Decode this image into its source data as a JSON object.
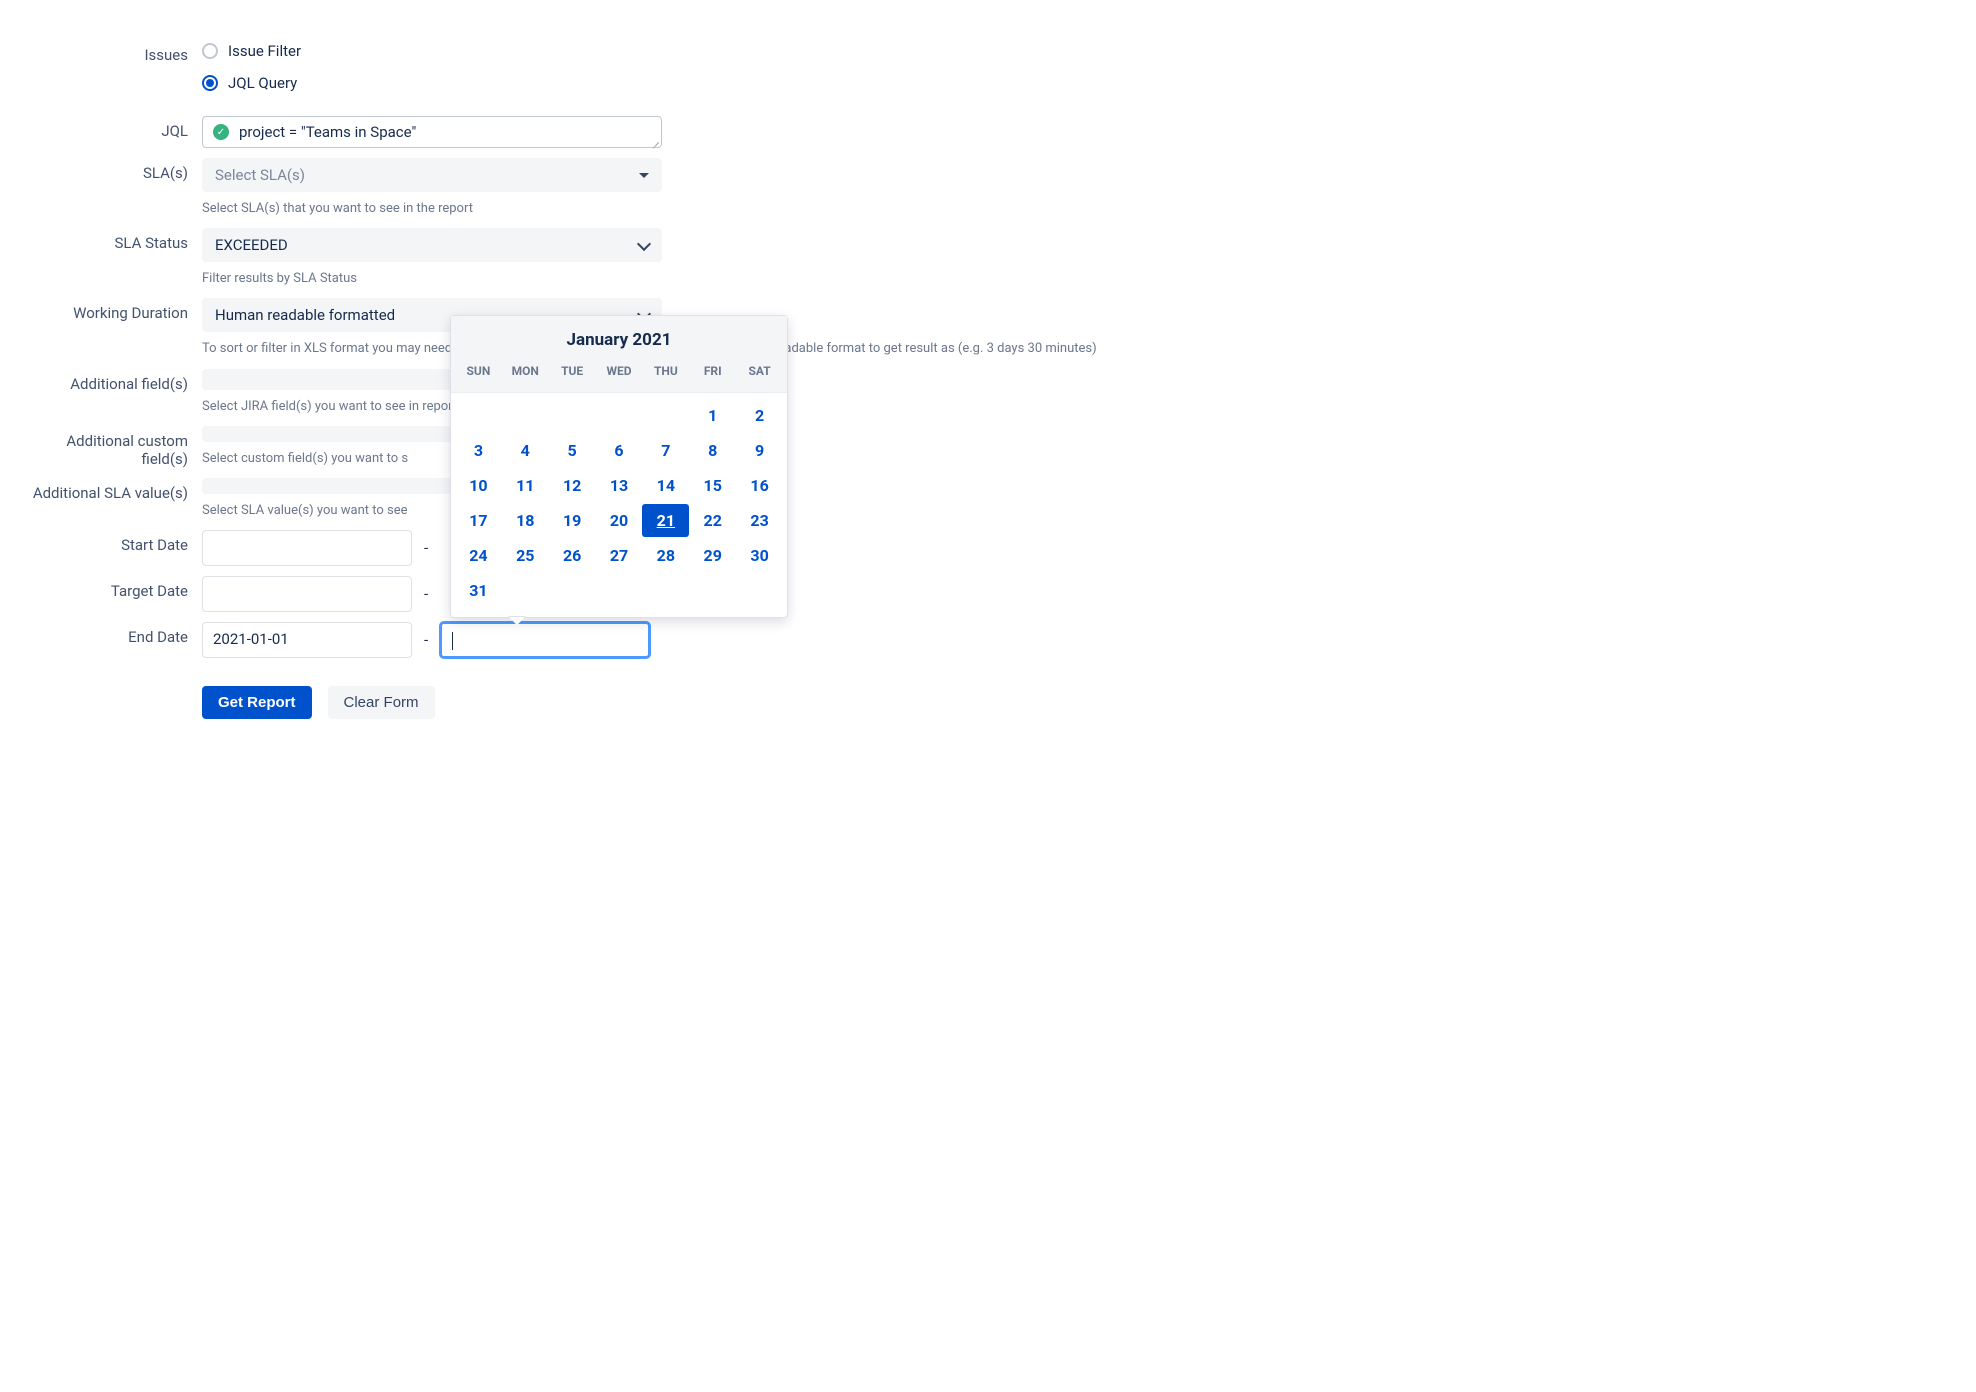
{
  "labels": {
    "issues": "Issues",
    "jql": "JQL",
    "slas": "SLA(s)",
    "sla_status": "SLA Status",
    "working_duration": "Working Duration",
    "additional_fields": "Additional field(s)",
    "additional_custom_fields": "Additional custom field(s)",
    "additional_sla_values": "Additional SLA value(s)",
    "start_date": "Start Date",
    "target_date": "Target Date",
    "end_date": "End Date"
  },
  "issues": {
    "option_filter": "Issue Filter",
    "option_jql": "JQL Query",
    "selected": "jql"
  },
  "jql_value": "project = \"Teams in Space\"",
  "slas": {
    "placeholder": "Select SLA(s)",
    "hint": "Select SLA(s) that you want to see in the report"
  },
  "sla_status": {
    "value": "EXCEEDED",
    "hint": "Filter results by SLA Status"
  },
  "working_duration": {
    "value": "Human readable formatted",
    "hint": "To sort or filter in XLS format you may need to get the actual number value, or simply select human readable format to get result as (e.g. 3 days 30 minutes)"
  },
  "additional_fields": {
    "hint": "Select JIRA field(s) you want to see in report"
  },
  "additional_custom_fields": {
    "hint": "Select custom field(s) you want to s"
  },
  "additional_sla_values": {
    "hint": "Select SLA value(s) you want to see"
  },
  "end_date": {
    "from_value": "2021-01-01"
  },
  "dash": "-",
  "buttons": {
    "get_report": "Get Report",
    "clear_form": "Clear Form"
  },
  "calendar": {
    "title": "January 2021",
    "weekdays": [
      "SUN",
      "MON",
      "TUE",
      "WED",
      "THU",
      "FRI",
      "SAT"
    ],
    "leading_empty": 5,
    "days": 31,
    "selected_day": 21
  }
}
